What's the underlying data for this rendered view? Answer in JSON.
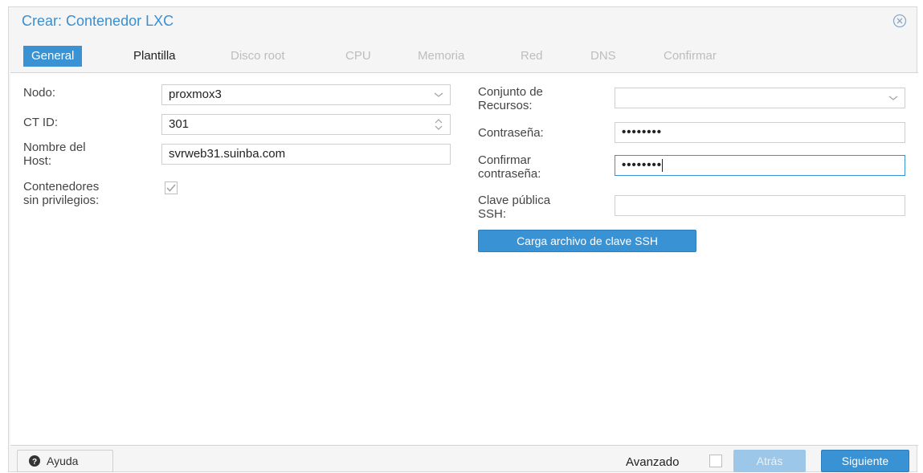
{
  "window": {
    "title": "Crear: Contenedor LXC",
    "close_icon": "close-circle-icon"
  },
  "tabs": [
    {
      "label": "General",
      "state": "active"
    },
    {
      "label": "Plantilla",
      "state": "enabled"
    },
    {
      "label": "Disco root",
      "state": "disabled"
    },
    {
      "label": "CPU",
      "state": "disabled"
    },
    {
      "label": "Memoria",
      "state": "disabled"
    },
    {
      "label": "Red",
      "state": "disabled"
    },
    {
      "label": "DNS",
      "state": "disabled"
    },
    {
      "label": "Confirmar",
      "state": "disabled"
    }
  ],
  "form_left": {
    "node_label": "Nodo:",
    "node_value": "proxmox3",
    "ctid_label": "CT ID:",
    "ctid_value": "301",
    "hostname_label_1": "Nombre del",
    "hostname_label_2": "Host:",
    "hostname_value": "svrweb31.suinba.com",
    "unpriv_label_1": "Contenedores",
    "unpriv_label_2": "sin privilegios:",
    "unpriv_checked": true
  },
  "form_right": {
    "pool_label_1": "Conjunto de",
    "pool_label_2": "Recursos:",
    "pool_value": "",
    "password_label": "Contraseña:",
    "password_value": "••••••••",
    "confirm_label_1": "Confirmar",
    "confirm_label_2": "contraseña:",
    "confirm_value": "••••••••",
    "ssh_label_1": "Clave pública",
    "ssh_label_2": "SSH:",
    "ssh_value": "",
    "ssh_load_button": "Carga archivo de clave SSH"
  },
  "footer": {
    "help_label": "Ayuda",
    "advanced_label": "Avanzado",
    "advanced_checked": false,
    "back_label": "Atrás",
    "next_label": "Siguiente"
  },
  "colors": {
    "accent": "#3892d4",
    "title": "#3a8fd0",
    "disabled_tab": "#bdbdbd"
  }
}
